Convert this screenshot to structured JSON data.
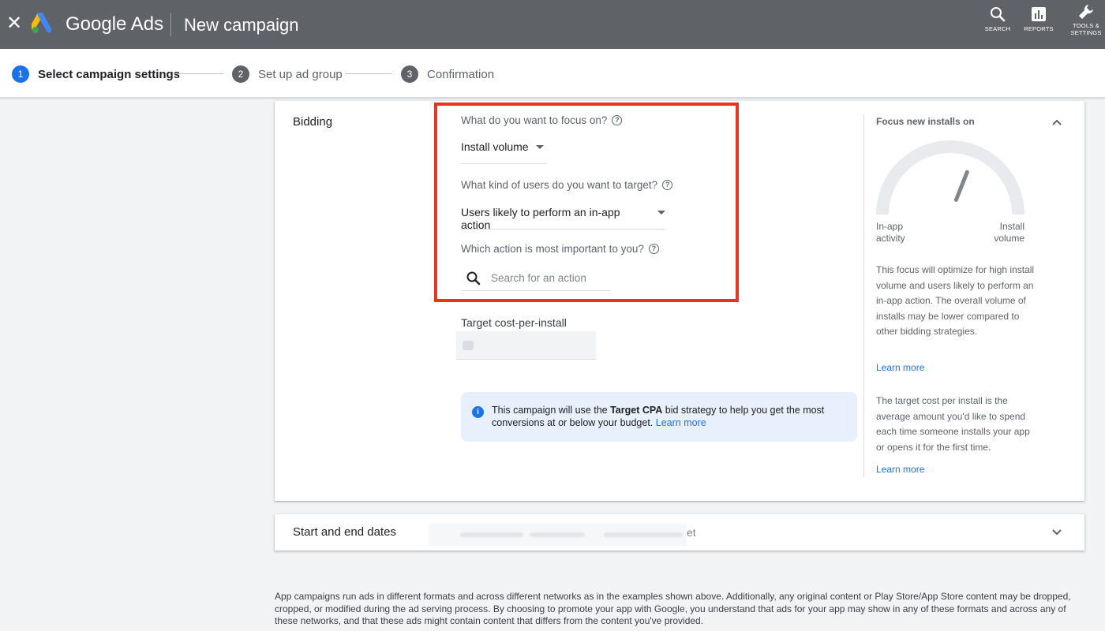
{
  "header": {
    "brand": "Google Ads",
    "title": "New campaign",
    "close_icon": "close-icon",
    "buttons": [
      {
        "label": "SEARCH",
        "icon": "search-icon"
      },
      {
        "label": "REPORTS",
        "icon": "reports-icon"
      },
      {
        "label": "TOOLS &",
        "label2": "SETTINGS",
        "icon": "wrench-icon"
      }
    ]
  },
  "stepper": {
    "steps": [
      {
        "number": "1",
        "label": "Select campaign settings",
        "active": true
      },
      {
        "number": "2",
        "label": "Set up ad group",
        "active": false
      },
      {
        "number": "3",
        "label": "Confirmation",
        "active": false
      }
    ]
  },
  "bidding": {
    "section_title": "Bidding",
    "focus_question": "What do you want to focus on?",
    "focus_value": "Install volume",
    "users_question": "What kind of users do you want to target?",
    "users_value": "Users likely to perform an in-app action",
    "action_question": "Which action is most important to you?",
    "action_placeholder": "Search for an action",
    "target_cpi_label": "Target cost-per-install",
    "info": {
      "prefix": "This campaign will use the ",
      "strategy": "Target CPA",
      "suffix": " bid strategy to help you get the most conversions at or below your budget. ",
      "link": "Learn more"
    }
  },
  "side_panel": {
    "title": "Focus new installs on",
    "gauge_left_label": [
      "In-app",
      "activity"
    ],
    "gauge_right_label": [
      "Install",
      "volume"
    ],
    "gauge_level": 0.62,
    "description": "This focus will optimize for high install volume and users likely to perform an in-app action. The overall volume of installs may be lower compared to other bidding strategies.",
    "link1": "Learn more",
    "description2": "The target cost per install is the average amount you'd like to spend each time someone installs your app or opens it for the first time.",
    "link2": "Learn more"
  },
  "dates": {
    "section_title": "Start and end dates",
    "visible_tail": "et"
  },
  "footer": {
    "text": "App campaigns run ads in different formats and across different networks as in the examples shown above. Additionally, any original content or Play Store/App Store content may be dropped, cropped, or modified during the ad serving process. By choosing to promote your app with Google, you understand that ads for your app may show in any of these formats and across any of these networks, and that these ads might contain content that differs from the content you've provided."
  },
  "colors": {
    "topbar": "#5f6368",
    "accent": "#1a73e8",
    "highlight": "#ea3323",
    "info_bg": "#e8f0fe"
  }
}
